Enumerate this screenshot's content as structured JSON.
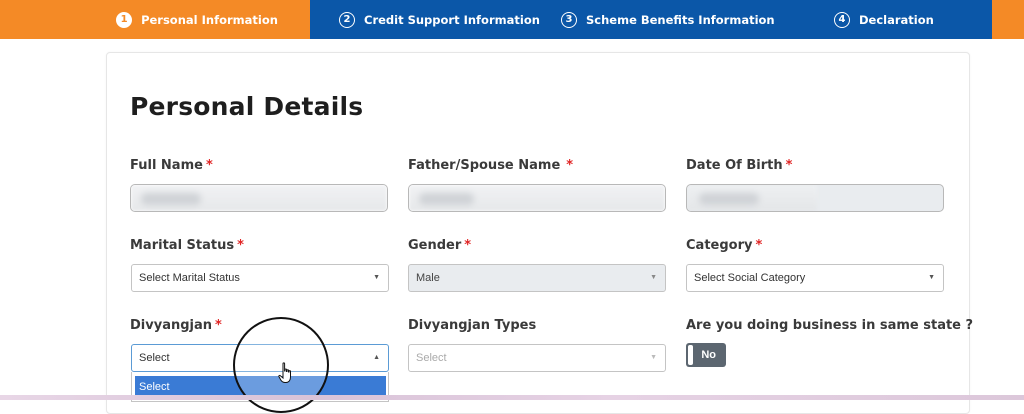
{
  "stepper": {
    "steps": [
      {
        "num": "1",
        "label": "Personal Information"
      },
      {
        "num": "2",
        "label": "Credit Support Information"
      },
      {
        "num": "3",
        "label": "Scheme Benefits Information"
      },
      {
        "num": "4",
        "label": "Declaration"
      }
    ],
    "active_step": 1,
    "colors": {
      "active": "#f48a26",
      "bar": "#0b57a8"
    }
  },
  "form": {
    "title": "Personal Details",
    "full_name": {
      "label": "Full Name",
      "required": "*"
    },
    "father_spouse_name": {
      "label": "Father/Spouse Name",
      "required": "*"
    },
    "date_of_birth": {
      "label": "Date Of Birth",
      "required": "*"
    },
    "marital_status": {
      "label": "Marital Status",
      "required": "*",
      "value": "Select Marital Status"
    },
    "gender": {
      "label": "Gender",
      "required": "*",
      "value": "Male"
    },
    "category": {
      "label": "Category",
      "required": "*",
      "value": "Select Social Category"
    },
    "divyangjan": {
      "label": "Divyangjan",
      "required": "*",
      "value": "Select",
      "open_option": "Select"
    },
    "divyangjan_types": {
      "label": "Divyangjan Types",
      "value": "Select"
    },
    "same_state": {
      "label": "Are you doing business in same state ?",
      "toggle": "No"
    }
  }
}
